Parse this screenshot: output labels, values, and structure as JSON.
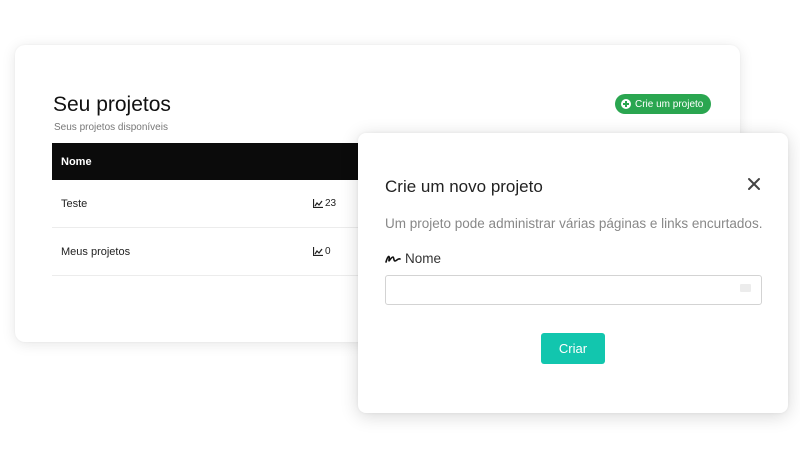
{
  "projects_panel": {
    "title": "Seu projetos",
    "subtitle": "Seus projetos disponíveis",
    "create_button_label": "Crie um projeto",
    "table": {
      "columns": [
        "Nome"
      ],
      "rows": [
        {
          "name": "Teste",
          "count": "23"
        },
        {
          "name": "Meus projetos",
          "count": "0"
        }
      ]
    }
  },
  "modal": {
    "title": "Crie um novo projeto",
    "description": "Um projeto pode administrar várias páginas e links encurtados.",
    "field_label": "Nome",
    "field_value": "",
    "field_placeholder": "",
    "submit_label": "Criar",
    "icons": {
      "close": "close-icon",
      "field": "signature-icon"
    }
  },
  "colors": {
    "create_button": "#2aa650",
    "table_header": "#0b0b0b",
    "submit_button": "#12c6ae"
  }
}
